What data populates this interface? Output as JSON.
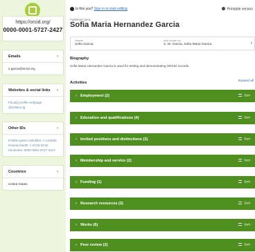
{
  "sidebar": {
    "orcid_url": "https://orcid.org/",
    "orcid_id": "0000-0001-5727-2427",
    "cards": [
      {
        "title": "Emails",
        "lines": [
          "s.garcia@orcid.org"
        ]
      },
      {
        "title": "Websites & social links",
        "lines": [
          "Faculty profile webpage",
          "@sofiaorcig"
        ]
      },
      {
        "title": "Other IDs",
        "lines": [
          "Profile system identifier: A-123456",
          "ResearcherID: L-9716-2018",
          "eScientist: 9000-0001-5727-2427"
        ]
      },
      {
        "title": "Countries",
        "lines": [
          "United States"
        ]
      }
    ]
  },
  "header": {
    "is_this_you": "Is this you?",
    "sign_in_link": "Sign in to start editing",
    "printable": "Printable version"
  },
  "profile": {
    "published_label": "Published name",
    "published_name": "Sofia Maria Hernandez Garcia",
    "names_label": "Names",
    "names_value": "Sofia Garcia",
    "also_known_label": "Also known as",
    "also_known_value": "S. M. Garcia, Sofia Maria Garcia"
  },
  "biography": {
    "title": "Biography",
    "text": "Sofia Maria Hernandez Garcia is used for testing and demonstrating ORCID records."
  },
  "activities": {
    "title": "Activities",
    "expand_all": "Expand all",
    "sort_label": "Sort",
    "sections": [
      {
        "label": "Employment (2)"
      },
      {
        "label": "Education and qualifications (4)"
      },
      {
        "label": "Invited positions and distinctions (3)"
      },
      {
        "label": "Membership and service (2)"
      },
      {
        "label": "Funding (1)"
      },
      {
        "label": "Research resources (2)"
      },
      {
        "label": "Works (6)"
      },
      {
        "label": "Peer review (2)"
      }
    ]
  },
  "colors": {
    "sidebar_bg": "#edf5dc",
    "activity_bar": "#4e8f1f",
    "link": "#2a6ebd",
    "orcid_green": "#a6ce39"
  }
}
